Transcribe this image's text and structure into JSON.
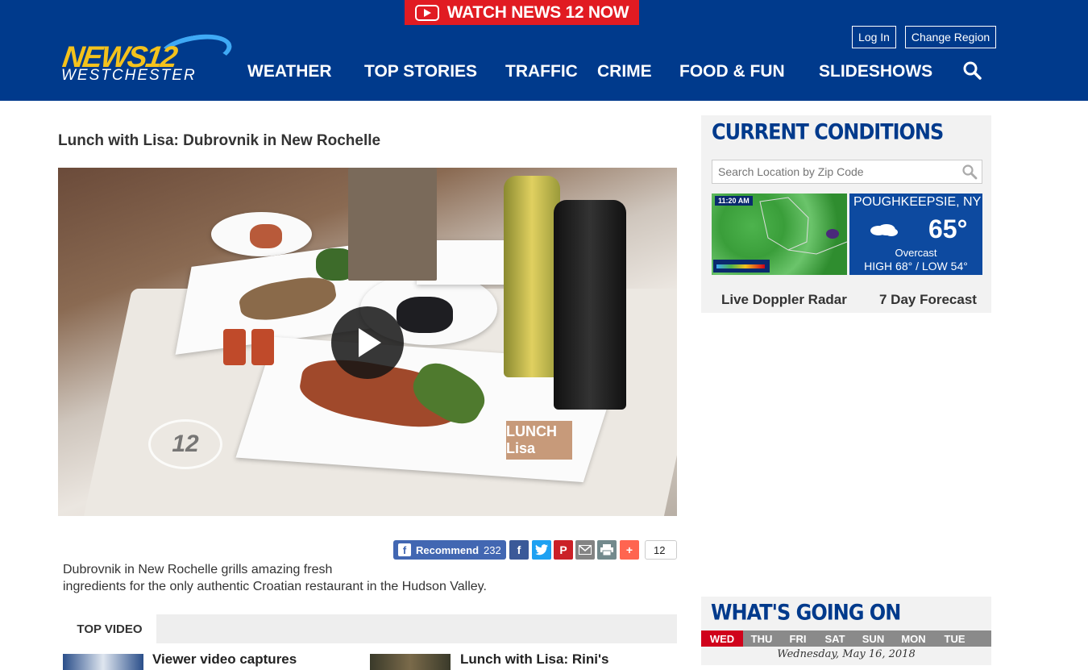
{
  "header": {
    "watch_label": "WATCH NEWS 12 NOW",
    "logo_top": "NEWS12",
    "logo_sub": "WESTCHESTER",
    "nav": [
      "WEATHER",
      "TOP STORIES",
      "TRAFFIC",
      "CRIME",
      "FOOD & FUN",
      "SLIDESHOWS"
    ],
    "login_label": "Log In",
    "change_region_label": "Change Region"
  },
  "article": {
    "title": "Lunch with Lisa: Dubrovnik in New Rochelle",
    "description_line1": "Dubrovnik in New Rochelle grills amazing fresh",
    "description_line2": "ingredients for the only authentic Croatian restaurant in the Hudson Valley.",
    "video_watermark": "12",
    "video_badge": "LUNCH Lisa"
  },
  "share": {
    "recommend_label": "Recommend",
    "recommend_count": "232",
    "share_count": "12",
    "icons": [
      "facebook-icon",
      "twitter-icon",
      "pinterest-icon",
      "email-icon",
      "print-icon",
      "addthis-icon"
    ]
  },
  "top_video": {
    "label": "TOP VIDEO",
    "items": [
      {
        "title": "Viewer video captures"
      },
      {
        "title": "Lunch with Lisa: Rini's"
      }
    ]
  },
  "conditions": {
    "title": "CURRENT CONDITIONS",
    "search_placeholder": "Search Location by Zip Code",
    "radar_time": "11:20 AM",
    "city": "POUGHKEEPSIE, NY",
    "temp": "65°",
    "condition": "Overcast",
    "high_low": "HIGH 68° / LOW 54°",
    "link_radar": "Live Doppler Radar",
    "link_forecast": "7 Day Forecast"
  },
  "whats_going_on": {
    "title": "WHAT'S GOING ON",
    "days": [
      "WED",
      "THU",
      "FRI",
      "SAT",
      "SUN",
      "MON",
      "TUE"
    ],
    "active_day": "WED",
    "date": "Wednesday, May 16, 2018"
  },
  "colors": {
    "brand_blue": "#003a8c",
    "watch_red": "#e11b22",
    "active_day": "#d0021b"
  }
}
